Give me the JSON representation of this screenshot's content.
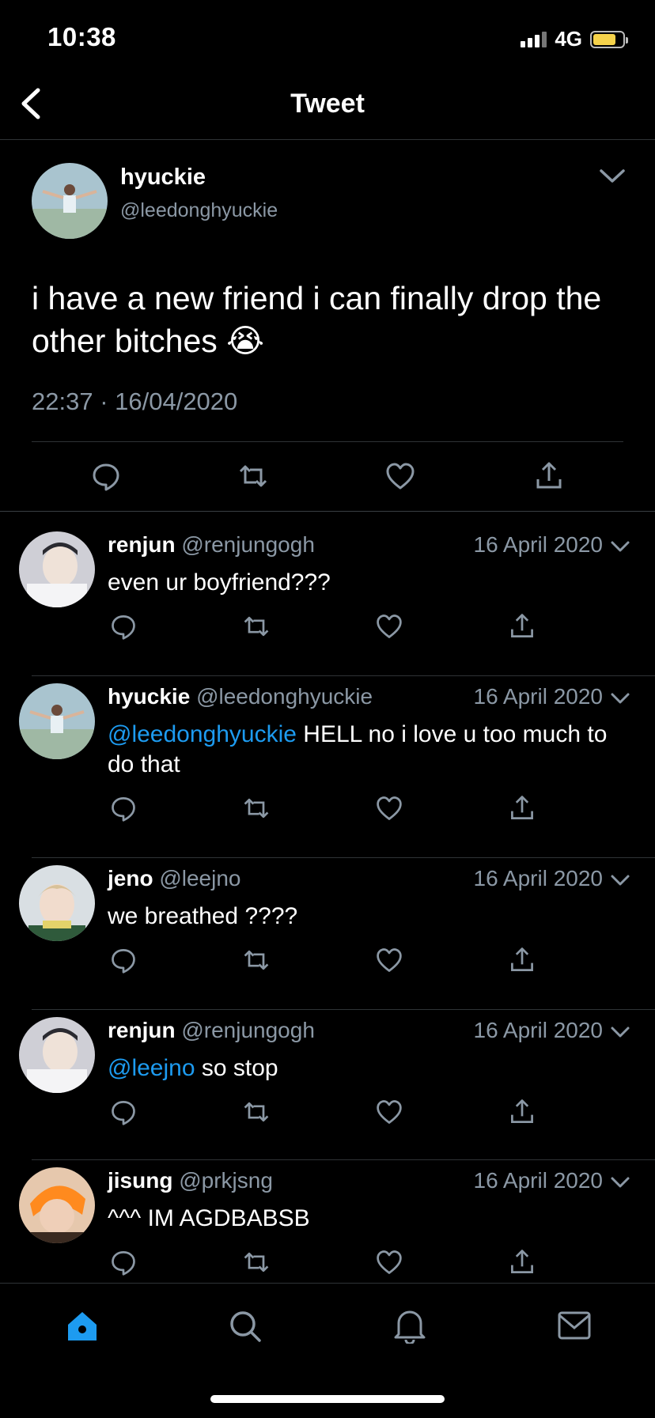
{
  "status": {
    "time": "10:38",
    "network": "4G",
    "battery_level": 0.7
  },
  "nav": {
    "title": "Tweet"
  },
  "tweet": {
    "author_name": "hyuckie",
    "author_handle": "@leedonghyuckie",
    "text": "i have a new friend i can finally drop the other bitches 😭",
    "timestamp": "22:37 · 16/04/2020"
  },
  "replies": [
    {
      "name": "renjun",
      "handle": "@renjungogh",
      "date": "16 April 2020",
      "mention": "",
      "text": "even ur boyfriend???"
    },
    {
      "name": "hyuckie",
      "handle": "@leedonghyuckie",
      "date": "16 April 2020",
      "mention": "@leedonghyuckie",
      "text": " HELL no i love u too much to do that"
    },
    {
      "name": "jeno",
      "handle": "@leejno",
      "date": "16 April 2020",
      "mention": "",
      "text": "we breathed ????"
    },
    {
      "name": "renjun",
      "handle": "@renjungogh",
      "date": "16 April 2020",
      "mention": "@leejno",
      "text": " so stop"
    },
    {
      "name": "jisung",
      "handle": "@prkjsng",
      "date": "16 April 2020",
      "mention": "",
      "text": "^^^ IM AGDBABSB"
    }
  ],
  "icons": {
    "reply": "reply-icon",
    "retweet": "retweet-icon",
    "like": "heart-icon",
    "share": "share-icon",
    "home": "home-icon",
    "search": "search-icon",
    "notifications": "bell-icon",
    "messages": "mail-icon"
  },
  "colors": {
    "accent": "#1d9bf0",
    "muted": "#8b98a5",
    "background": "#000000"
  }
}
